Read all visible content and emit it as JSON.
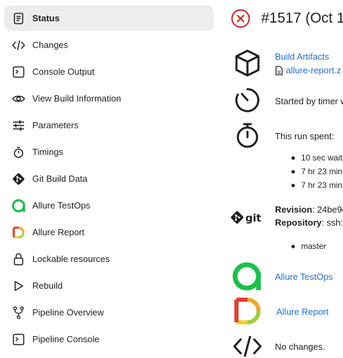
{
  "sidebar": {
    "items": [
      {
        "label": "Status",
        "icon": "document-icon"
      },
      {
        "label": "Changes",
        "icon": "code-icon"
      },
      {
        "label": "Console Output",
        "icon": "terminal-icon"
      },
      {
        "label": "View Build Information",
        "icon": "eye-icon"
      },
      {
        "label": "Parameters",
        "icon": "sliders-icon"
      },
      {
        "label": "Timings",
        "icon": "stopwatch-icon"
      },
      {
        "label": "Git Build Data",
        "icon": "git-icon"
      },
      {
        "label": "Allure TestOps",
        "icon": "allure-testops-icon"
      },
      {
        "label": "Allure Report",
        "icon": "allure-report-icon"
      },
      {
        "label": "Lockable resources",
        "icon": "lock-icon"
      },
      {
        "label": "Rebuild",
        "icon": "play-icon"
      },
      {
        "label": "Pipeline Overview",
        "icon": "branch-icon"
      },
      {
        "label": "Pipeline Console",
        "icon": "terminal-icon"
      }
    ]
  },
  "main": {
    "title": "#1517 (Oct 1",
    "status_color": "#d2201f",
    "artifacts": {
      "heading": "Build Artifacts",
      "file": "allure-report.z"
    },
    "started": "Started by timer w",
    "run_spent": {
      "label": "This run spent:",
      "items": [
        "10 sec wait",
        "7 hr 23 min",
        "7 hr 23 min"
      ]
    },
    "git": {
      "revision_label": "Revision",
      "revision_value": ": 24be9c",
      "repository_label": "Repository",
      "repository_value": ": ssh:/",
      "branches": [
        "master"
      ]
    },
    "allure_testops_link": "Allure TestOps",
    "allure_report_link": "Allure Report",
    "changes_text": "No changes."
  },
  "colors": {
    "link": "#1d6fd6",
    "active_bg": "#ededf0",
    "allure_green": "#19c14a",
    "error_red": "#d2201f"
  }
}
